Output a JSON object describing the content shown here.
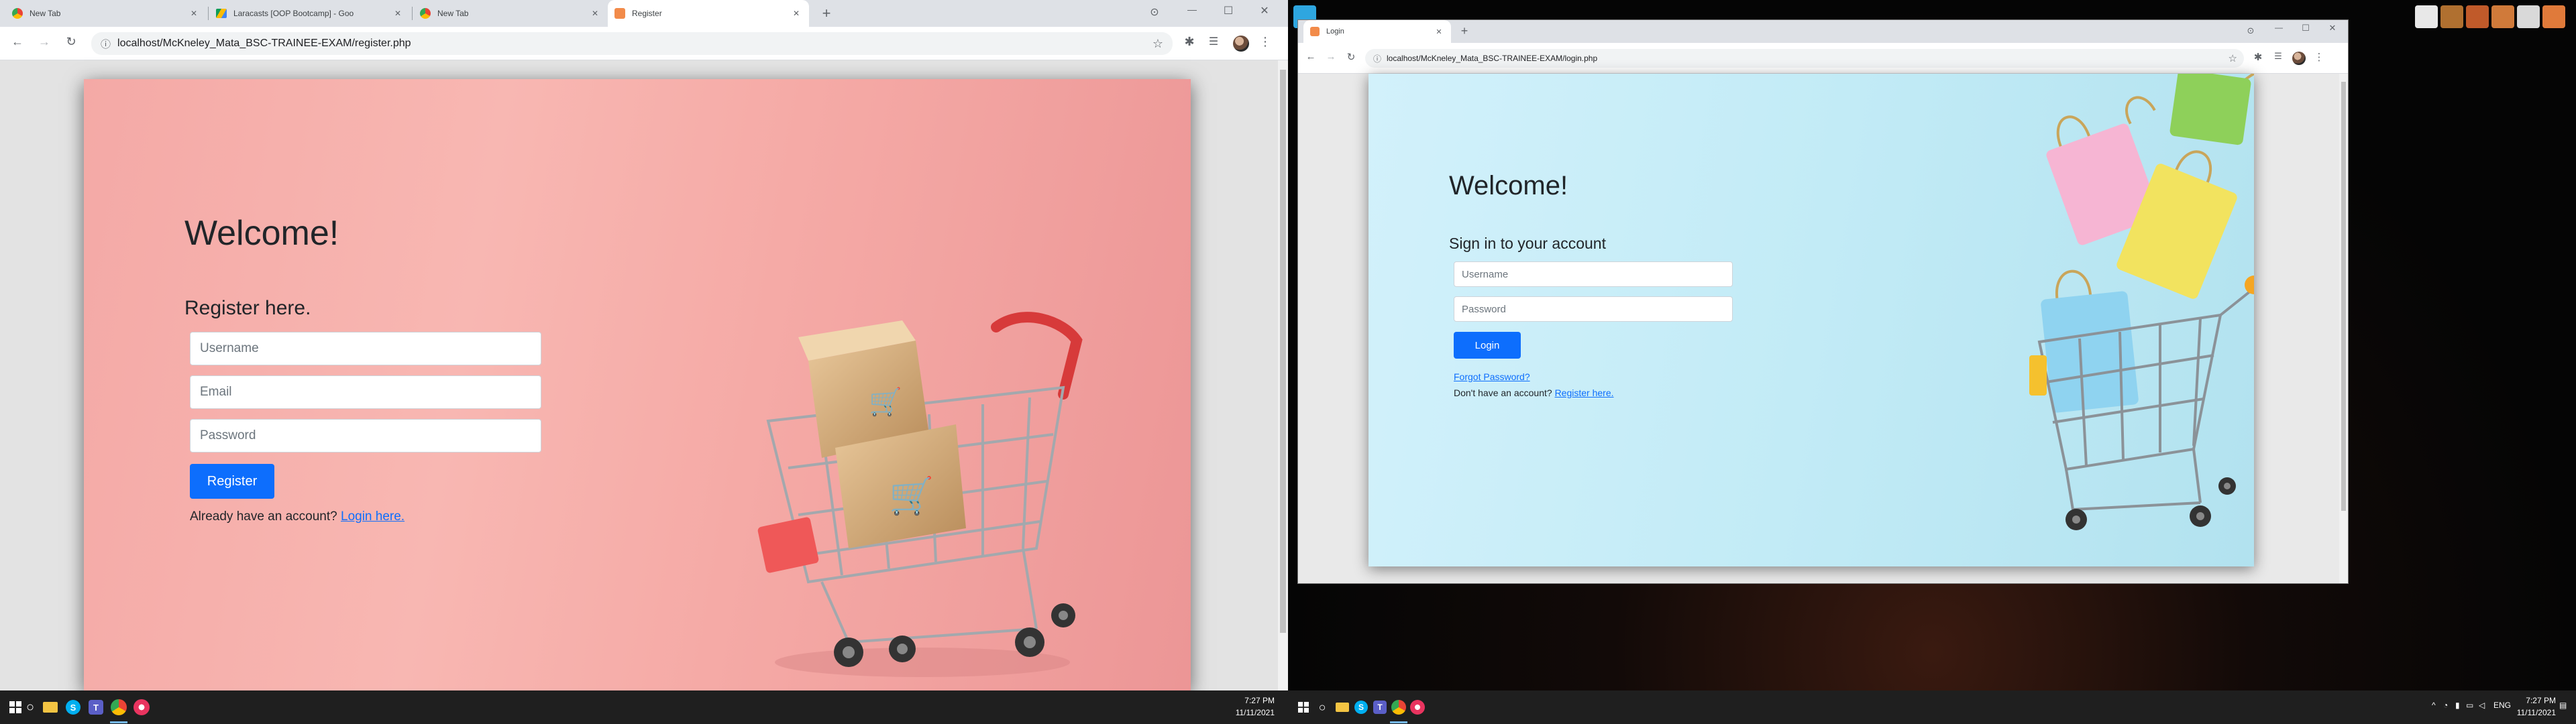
{
  "left_browser": {
    "tabs": [
      {
        "title": "New Tab",
        "active": false
      },
      {
        "title": "Laracasts [OOP Bootcamp] - Goo",
        "active": false
      },
      {
        "title": "New Tab",
        "active": false
      },
      {
        "title": "Register",
        "active": true
      }
    ],
    "url": "localhost/McKneley_Mata_BSC-TRAINEE-EXAM/register.php"
  },
  "register_page": {
    "welcome": "Welcome!",
    "subtitle": "Register here.",
    "username_placeholder": "Username",
    "email_placeholder": "Email",
    "password_placeholder": "Password",
    "register_button": "Register",
    "have_account_text": "Already have an account?",
    "login_link": "Login here."
  },
  "right_browser": {
    "tabs": [
      {
        "title": "Login",
        "active": true
      }
    ],
    "url": "localhost/McKneley_Mata_BSC-TRAINEE-EXAM/login.php"
  },
  "login_page": {
    "welcome": "Welcome!",
    "subtitle": "Sign in to your account",
    "username_placeholder": "Username",
    "password_placeholder": "Password",
    "login_button": "Login",
    "forgot_link": "Forgot Password?",
    "no_account_text": "Don't have an account?",
    "register_link": "Register here."
  },
  "taskbar_left": {
    "time": "7:27 PM",
    "date": "11/11/2021"
  },
  "taskbar_right": {
    "language": "ENG",
    "time": "7:27 PM",
    "date": "11/11/2021"
  },
  "icons": {
    "back": "←",
    "forward": "→",
    "reload": "↻",
    "info": "ⓘ",
    "star": "☆",
    "extensions": "✱",
    "menu": "⋮",
    "close": "✕",
    "new_tab": "+",
    "minimize": "—",
    "maximize": "☐",
    "search": "○"
  },
  "colors": {
    "primary_button": "#0d6efd",
    "register_bg": "#f4a9a6",
    "login_bg": "#c2ebf6"
  }
}
